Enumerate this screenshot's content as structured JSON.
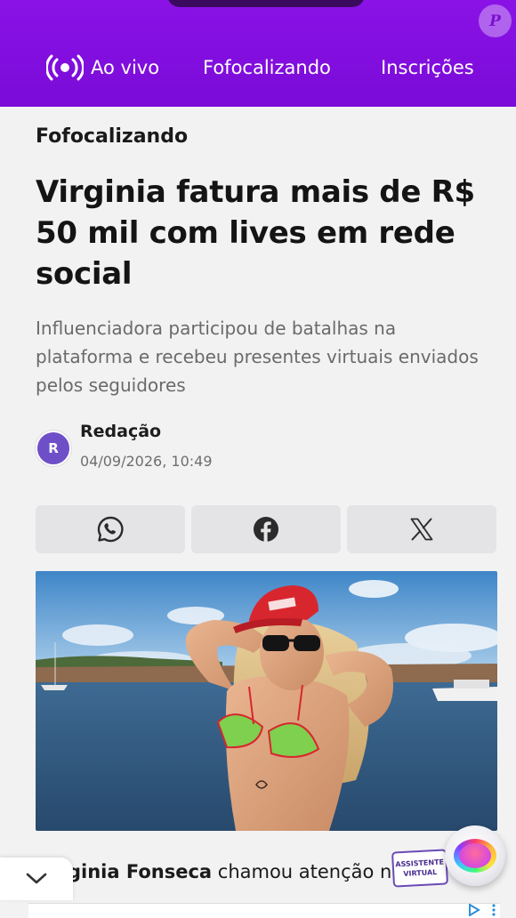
{
  "header": {
    "brand_badge": "P",
    "nav": [
      {
        "label": "Ao vivo",
        "icon": "live-broadcast-icon"
      },
      {
        "label": "Fofocalizando"
      },
      {
        "label": "Inscrições"
      }
    ],
    "colors": {
      "background": "#7a0bd8",
      "text": "#ffffff"
    }
  },
  "article": {
    "kicker": "Fofocalizando",
    "headline": "Virginia fatura mais de R$ 50 mil com lives em rede social",
    "subhead": "Influenciadora participou de batalhas na plataforma e recebeu presentes virtuais enviados pelos seguidores",
    "author": {
      "initial": "R",
      "name": "Redação",
      "date": "04/09/2026, 10:49"
    },
    "share": [
      {
        "icon": "whatsapp-icon"
      },
      {
        "icon": "facebook-icon"
      },
      {
        "icon": "x-icon"
      }
    ],
    "body_start": {
      "bold": "ginia Fonseca",
      "rest": " chamou atenção ne"
    }
  },
  "assistant": {
    "label": "ASSISTENTE VIRTUAL"
  }
}
